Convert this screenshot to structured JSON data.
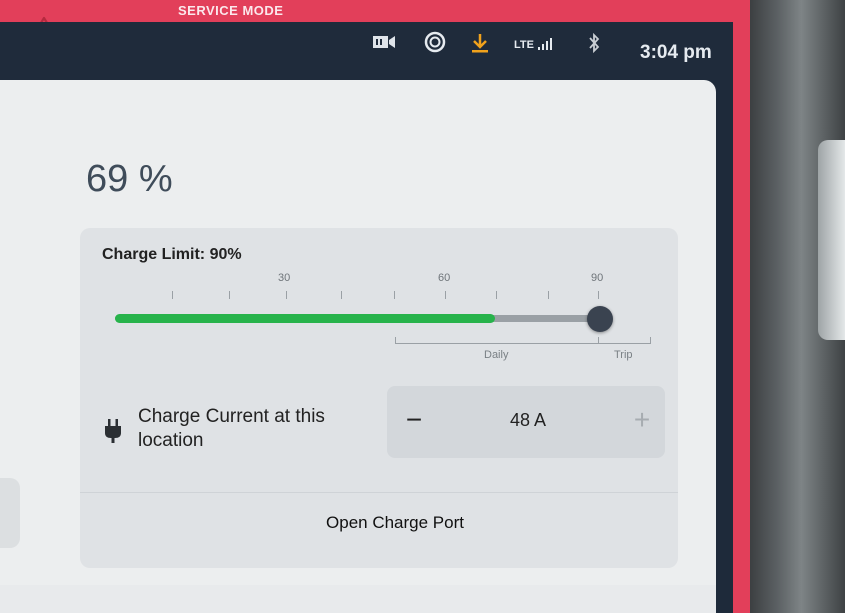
{
  "header": {
    "service_mode_label": "SERVICE MODE",
    "clock": "3:04 pm",
    "network_label": "LTE",
    "icons": [
      "warning-icon",
      "dashcam-icon",
      "recording-icon",
      "download-icon",
      "signal-icon",
      "bluetooth-icon"
    ]
  },
  "charging": {
    "battery_level_text": "69 %",
    "battery_level": 69,
    "charge_limit_label": "Charge Limit: 90%",
    "charge_limit": 90,
    "scale_labels": [
      "30",
      "60",
      "90"
    ],
    "daily_label": "Daily",
    "trip_label": "Trip",
    "charge_current_label": "Charge Current at this location",
    "charge_current_value": "48 A",
    "minus_label": "−",
    "plus_label": "+",
    "open_port_label": "Open Charge Port"
  },
  "colors": {
    "service_bar": "#e23f5a",
    "status_bar": "#1f2b3b",
    "panel": "#eceeef",
    "charge_fill": "#27b34b",
    "thumb": "#3a4350"
  }
}
